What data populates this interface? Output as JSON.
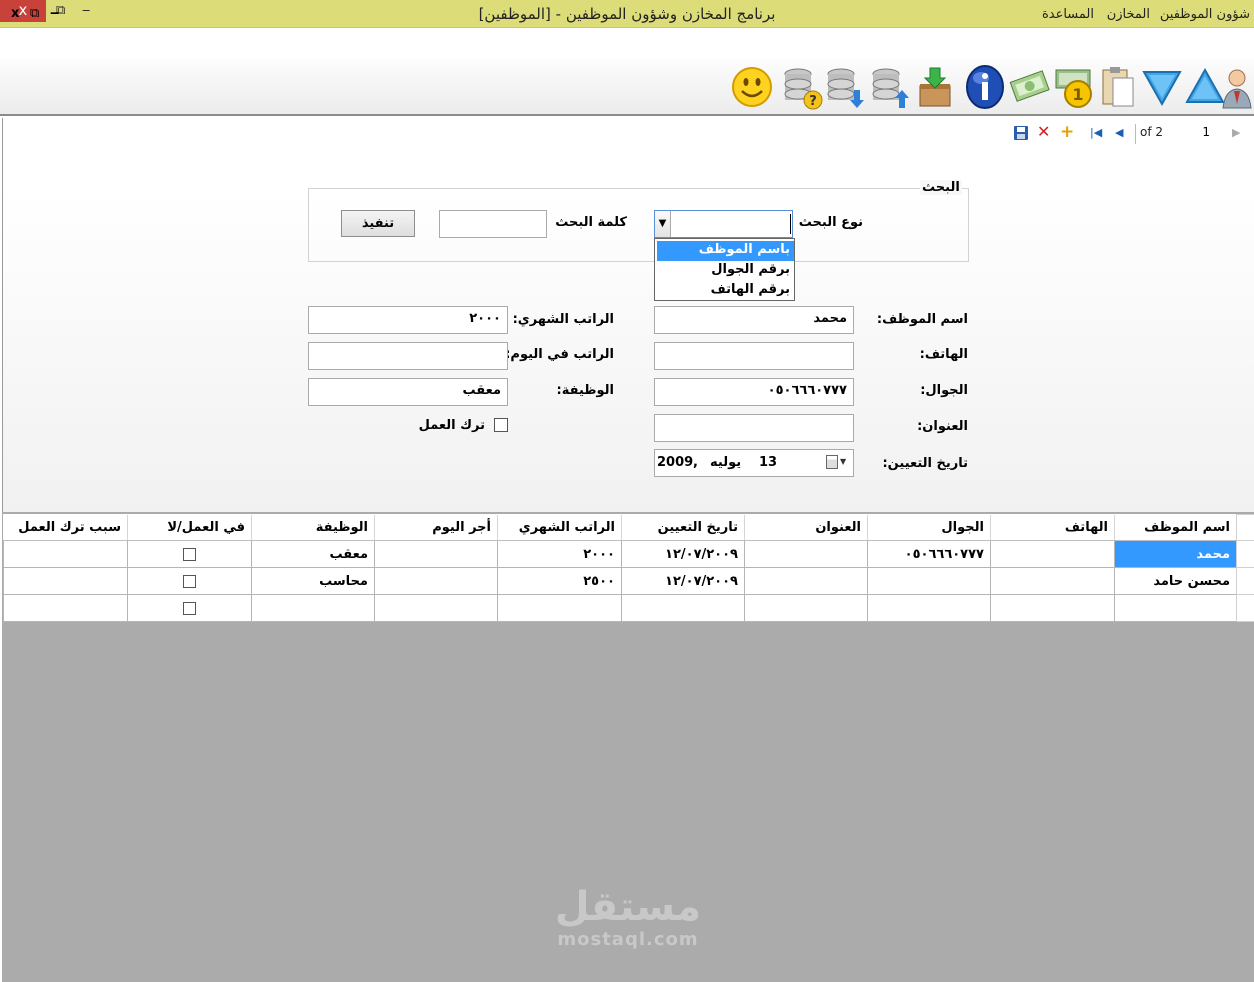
{
  "window": {
    "title": "برنامج المخازن وشؤون الموظفين - [الموظفين]",
    "close": "x",
    "restore": "⧉",
    "minimize": "‒"
  },
  "menu": {
    "items": [
      "شؤون الموظفين",
      "المخازن",
      "المساعدة"
    ],
    "mdi_close": "x",
    "mdi_restore": "⧉",
    "mdi_minimize": "‒"
  },
  "toolbar": {
    "icons": [
      "employee-icon",
      "move-up-icon",
      "move-down-icon",
      "clipboard-icon",
      "salary-icon",
      "money-icon",
      "info-icon",
      "box-download-icon",
      "database-upload-icon",
      "database-download-icon",
      "database-query-icon",
      "smiley-icon"
    ]
  },
  "navigator": {
    "position": "1",
    "of_label": "of 2"
  },
  "search": {
    "legend": "البحث",
    "type_label": "نوع البحث",
    "keyword_label": "كلمة البحث",
    "execute_label": "تنفيذ",
    "keyword_value": "",
    "combo_value": "",
    "options": [
      "باسم الموظف",
      "برقم الجوال",
      "برقم الهاتف"
    ],
    "selected_option": "باسم الموظف"
  },
  "form": {
    "name_label": "اسم الموظف:",
    "name_value": "محمد",
    "phone_label": "الهاتف:",
    "phone_value": "",
    "mobile_label": "الجوال:",
    "mobile_value": "٠٥٠٦٦٦٠٧٧٧",
    "address_label": "العنوان:",
    "address_value": "",
    "hire_date_label": "تاريخ التعيين:",
    "hire_day": "13",
    "hire_month": "يوليه",
    "hire_year": "2009",
    "hire_sep": ",",
    "monthly_salary_label": "الراتب الشهري:",
    "monthly_salary_value": "٢٠٠٠",
    "daily_salary_label": "الراتب في اليوم:",
    "daily_salary_value": "",
    "job_label": "الوظيفة:",
    "job_value": "معقب",
    "left_work_label": "ترك العمل"
  },
  "grid": {
    "columns": [
      "اسم الموظف",
      "الهاتف",
      "الجوال",
      "العنوان",
      "تاريخ التعيين",
      "الراتب الشهري",
      "أجر اليوم",
      "الوظيفة",
      "في العمل/لا",
      "سبب ترك العمل"
    ],
    "rows": [
      [
        "محمد",
        "",
        "٠٥٠٦٦٦٠٧٧٧",
        "",
        "١٢/٠٧/٢٠٠٩",
        "٢٠٠٠",
        "",
        "معقب",
        "",
        ""
      ],
      [
        "محسن حامد",
        "",
        "",
        "",
        "١٢/٠٧/٢٠٠٩",
        "٢٥٠٠",
        "",
        "محاسب",
        "",
        ""
      ],
      [
        "",
        "",
        "",
        "",
        "",
        "",
        "",
        "",
        "",
        ""
      ]
    ]
  },
  "watermark": {
    "arabic": "مستقل",
    "latin": "mostaql.com"
  }
}
